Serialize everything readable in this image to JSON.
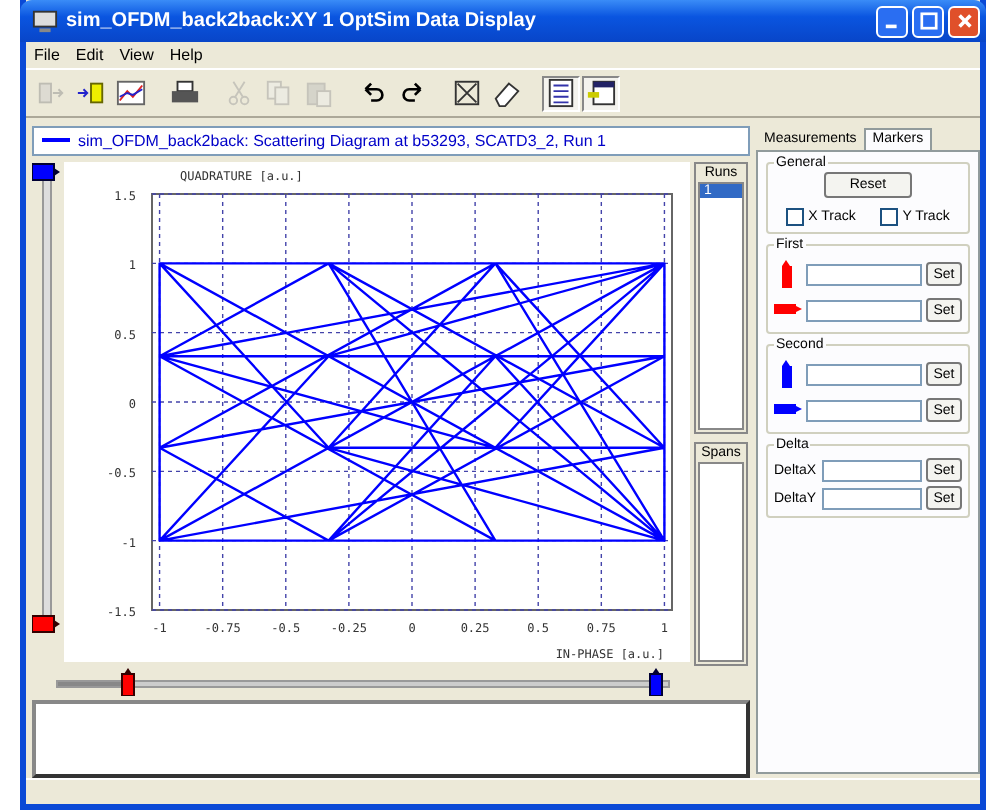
{
  "window": {
    "title": "sim_OFDM_back2back:XY 1 OptSim Data Display"
  },
  "menu": [
    "File",
    "Edit",
    "View",
    "Help"
  ],
  "toolbar": [
    {
      "kind": "export",
      "disabled": true,
      "pressed": false
    },
    {
      "kind": "import",
      "disabled": false,
      "pressed": false
    },
    {
      "kind": "chart",
      "disabled": false,
      "pressed": false
    },
    {
      "kind": "print",
      "disabled": false,
      "pressed": false
    },
    {
      "kind": "cut",
      "disabled": true,
      "pressed": false
    },
    {
      "kind": "copy",
      "disabled": true,
      "pressed": false
    },
    {
      "kind": "paste",
      "disabled": true,
      "pressed": false
    },
    {
      "kind": "undo",
      "disabled": false,
      "pressed": false
    },
    {
      "kind": "redo",
      "disabled": false,
      "pressed": false
    },
    {
      "kind": "fit",
      "disabled": false,
      "pressed": false
    },
    {
      "kind": "eraser",
      "disabled": false,
      "pressed": false
    },
    {
      "kind": "legend",
      "disabled": false,
      "pressed": true
    },
    {
      "kind": "window",
      "disabled": false,
      "pressed": true
    }
  ],
  "plot_title": "sim_OFDM_back2back: Scattering Diagram   at b53293, SCATD3_2, Run 1",
  "vertical_slider": {
    "top_marker": {
      "level": 1
    },
    "bottom_marker": {
      "level": 0
    }
  },
  "horizontal_slider": {
    "left_marker": {
      "level": 0.12
    },
    "right_marker": {
      "level": 1
    }
  },
  "chart": {
    "chart_data": {
      "type": "line",
      "xlabel": "IN-PHASE  [a.u.]",
      "ylabel": "QUADRATURE  [a.u.]",
      "grid": true,
      "x": [
        -1,
        1,
        -0.33,
        0.33,
        -1,
        1,
        -0.33,
        -1,
        0.33,
        1,
        -1,
        -0.33,
        1,
        0.33,
        -1,
        -0.33,
        1,
        0.33,
        -1,
        1,
        -1,
        0.33,
        -0.33,
        1,
        -0.33,
        0.33,
        -1,
        1,
        0.33,
        -0.33,
        1,
        -1,
        -1,
        1,
        1,
        -0.33,
        0.33,
        -1,
        -0.33,
        0.33,
        1
      ],
      "series": [
        {
          "color": "#0000ff",
          "values": [
            1,
            -1,
            1,
            -1,
            0.33,
            0.33,
            -1,
            -0.33,
            1,
            -0.33,
            -1,
            0.33,
            1,
            -0.33,
            1,
            -0.33,
            -1,
            0.33,
            -1,
            1,
            0.33,
            -1,
            1,
            -0.33,
            -0.33,
            1,
            -0.33,
            0.33,
            0.33,
            -1,
            1,
            1,
            -1,
            -1,
            1,
            0.33,
            -0.33,
            0.33,
            1,
            1,
            -1
          ]
        }
      ],
      "xlim": [
        -1.03,
        1.03
      ],
      "ylim": [
        -1.5,
        1.5
      ],
      "xticks": [
        -1,
        -0.75,
        -0.5,
        -0.25,
        0,
        0.25,
        0.5,
        0.75,
        1
      ],
      "yticks": [
        1.5,
        1,
        0.5,
        0,
        -0.5,
        -1,
        -1.5
      ]
    }
  },
  "runs": {
    "label": "Runs",
    "items": [
      {
        "label": "1",
        "selected": true
      }
    ]
  },
  "spans": {
    "label": "Spans"
  },
  "tabs": [
    {
      "label": "Measurements",
      "selected": false
    },
    {
      "label": "Markers",
      "selected": true
    }
  ],
  "general": {
    "label": "General",
    "button": "Reset",
    "checkboxes": [
      {
        "label": "X Track",
        "checked": false
      },
      {
        "label": "Y Track",
        "checked": false
      }
    ]
  },
  "groups": [
    {
      "label": "First",
      "rows": [
        {
          "kind": "vmarker",
          "color": "#ff0000",
          "button": "Set"
        },
        {
          "kind": "hmarker",
          "color": "#ff0000",
          "button": "Set"
        }
      ]
    },
    {
      "label": "Second",
      "rows": [
        {
          "kind": "vmarker",
          "color": "#0000ff",
          "button": "Set"
        },
        {
          "kind": "hmarker",
          "color": "#0000ff",
          "button": "Set"
        }
      ]
    },
    {
      "label": "Delta",
      "rows": [
        {
          "kind": "text",
          "label": "DeltaX",
          "button": "Set"
        },
        {
          "kind": "text",
          "label": "DeltaY",
          "button": "Set"
        }
      ]
    }
  ]
}
